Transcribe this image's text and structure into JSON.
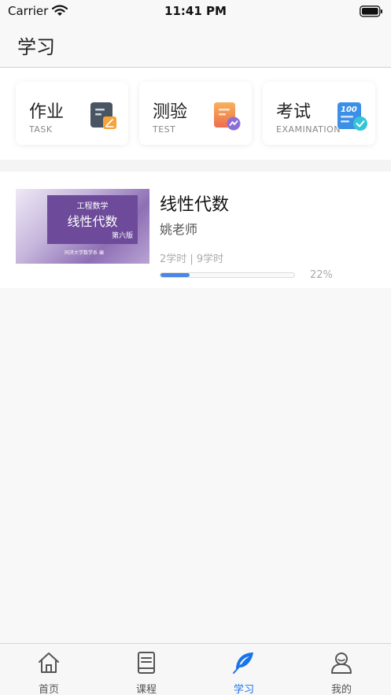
{
  "status_bar": {
    "carrier": "Carrier",
    "time": "11:41 PM"
  },
  "nav": {
    "title": "学习"
  },
  "quick_actions": [
    {
      "title": "作业",
      "subtitle": "TASK",
      "icon": "homework-icon"
    },
    {
      "title": "测验",
      "subtitle": "TEST",
      "icon": "quiz-icon"
    },
    {
      "title": "考试",
      "subtitle": "EXAMINATION",
      "icon": "exam-icon"
    }
  ],
  "exam_icon_text": "100",
  "course": {
    "name": "线性代数",
    "teacher": "姚老师",
    "hours": "2学时 | 9学时",
    "progress_text": "22%",
    "progress": 0.22,
    "cover": {
      "series": "工程数学",
      "title": "线性代数",
      "edition": "第六版",
      "publisher": "同济大学数学系 编"
    }
  },
  "tabs": [
    {
      "label": "首页",
      "icon": "home-icon",
      "active": false
    },
    {
      "label": "课程",
      "icon": "book-icon",
      "active": false
    },
    {
      "label": "学习",
      "icon": "feather-icon",
      "active": true
    },
    {
      "label": "我的",
      "icon": "profile-icon",
      "active": false
    }
  ],
  "colors": {
    "accent": "#1a73e8",
    "progress": "#4a86e8",
    "cover_purple": "#6d4b9a"
  }
}
